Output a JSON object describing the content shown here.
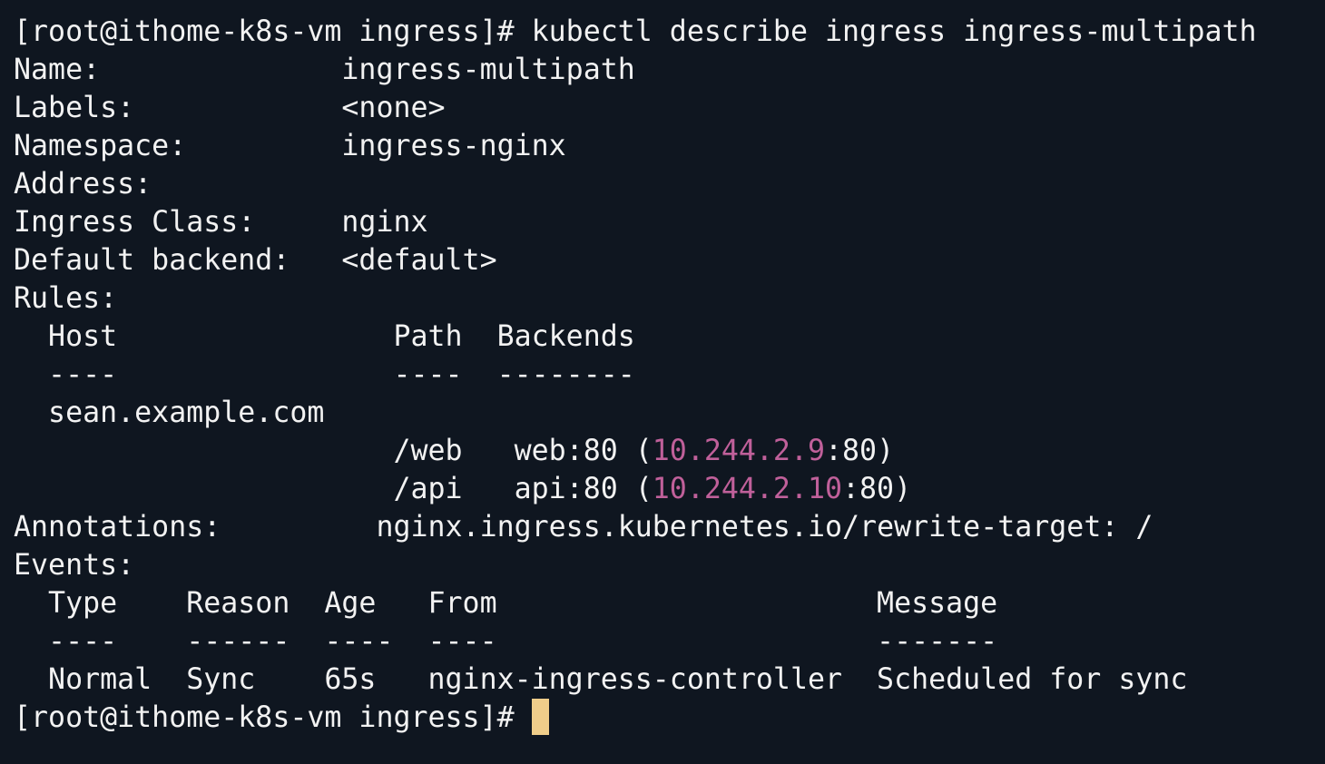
{
  "colors": {
    "background": "#0f1620",
    "foreground": "#f2f2f2",
    "ip_highlight": "#c0609a",
    "cursor": "#efcd8a"
  },
  "terminal": {
    "prompt": "[root@ithome-k8s-vm ingress]# ",
    "command": "kubectl describe ingress ingress-multipath",
    "lines": {
      "name_label": "Name:              ",
      "name_value": "ingress-multipath",
      "labels_label": "Labels:            ",
      "labels_value": "<none>",
      "namespace_label": "Namespace:         ",
      "namespace_value": "ingress-nginx",
      "address_label": "Address:",
      "class_label": "Ingress Class:     ",
      "class_value": "nginx",
      "backend_label": "Default backend:   ",
      "backend_value": "<default>",
      "rules_label": "Rules:",
      "rules_header": "  Host                Path  Backends",
      "rules_divider": "  ----                ----  --------",
      "rule_host": "  sean.example.com",
      "rule1_prefix": "                      /web   web:80 (",
      "rule1_ip": "10.244.2.9",
      "rule1_suffix": ":80)",
      "rule2_prefix": "                      /api   api:80 (",
      "rule2_ip": "10.244.2.10",
      "rule2_suffix": ":80)",
      "annotations_label": "Annotations:         ",
      "annotations_value": "nginx.ingress.kubernetes.io/rewrite-target: /",
      "events_label": "Events:",
      "events_header": "  Type    Reason  Age   From                      Message",
      "events_divider": "  ----    ------  ----  ----                      -------",
      "event_row": "  Normal  Sync    65s   nginx-ingress-controller  Scheduled for sync"
    }
  }
}
